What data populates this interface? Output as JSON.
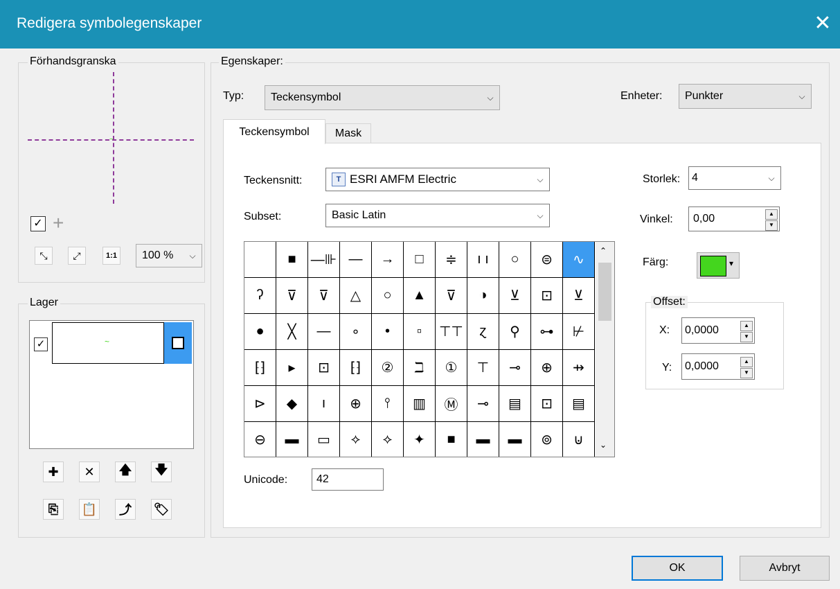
{
  "window": {
    "title": "Redigera symbolegenskaper",
    "close_icon": "close-icon"
  },
  "preview": {
    "label": "Förhandsgranska",
    "checkbox_checked": true,
    "zoom": "100 %",
    "toolbar_icons": [
      "zoom-in-icon",
      "zoom-out-icon",
      "actual-size-icon"
    ],
    "toolbar_glyphs": {
      "fit": "⤡",
      "full": "⤢",
      "actual": "1:1"
    }
  },
  "layers": {
    "label": "Lager",
    "items": [
      {
        "checked": true,
        "preview_glyph": "~",
        "lock_icon": "layer-lock-icon"
      }
    ],
    "buttons_row1": [
      {
        "name": "add-layer-button",
        "glyph": "✚"
      },
      {
        "name": "remove-layer-button",
        "glyph": "✕"
      },
      {
        "name": "move-up-button",
        "glyph": "🡅"
      },
      {
        "name": "move-down-button",
        "glyph": "🡇"
      }
    ],
    "buttons_row2": [
      {
        "name": "copy-button",
        "glyph": "⎘"
      },
      {
        "name": "paste-button",
        "glyph": "📋"
      },
      {
        "name": "reset-button",
        "glyph": "⤴"
      },
      {
        "name": "tag-button",
        "glyph": "🏷"
      }
    ]
  },
  "properties": {
    "label": "Egenskaper:",
    "type_label": "Typ:",
    "type_value": "Teckensymbol",
    "units_label": "Enheter:",
    "units_value": "Punkter",
    "tabs": [
      {
        "label": "Teckensymbol",
        "active": true
      },
      {
        "label": "Mask",
        "active": false
      }
    ],
    "font_label": "Teckensnitt:",
    "font_value": "ESRI AMFM Electric",
    "subset_label": "Subset:",
    "subset_value": "Basic Latin",
    "unicode_label": "Unicode:",
    "unicode_value": "42",
    "size_label": "Storlek:",
    "size_value": "4",
    "angle_label": "Vinkel:",
    "angle_value": "0,00",
    "color_label": "Färg:",
    "color_value": "#44d61e",
    "offset_label": "Offset:",
    "x_label": "X:",
    "x_value": "0,0000",
    "y_label": "Y:",
    "y_value": "0,0000"
  },
  "glyphs": [
    [
      " ",
      "■",
      "—⊪",
      "—",
      "→",
      "□",
      "≑",
      "ı ı",
      "○",
      "⊜",
      "∿"
    ],
    [
      "ʔ",
      "⊽",
      "⊽",
      "△",
      "○",
      "▲",
      "⊽",
      "◑",
      "⊻",
      "⊡",
      "⊻"
    ],
    [
      "●",
      "╳",
      "—",
      "∘",
      "•",
      "▫",
      "⊤⊤",
      "ɀ",
      "⚲",
      "⊶",
      "⊬"
    ],
    [
      "⁅⁆",
      "▸",
      "⊡",
      "⁅⁆",
      "②",
      "ℶ",
      "①",
      "⊤",
      "⊸",
      "⊕",
      "⇸"
    ],
    [
      "⊳",
      "◆",
      "ı",
      "⊕",
      "⫯",
      "▥",
      "Ⓜ",
      "⊸",
      "▤",
      "⊡",
      "▤"
    ],
    [
      "⊖",
      "▬",
      "▭",
      "⟡",
      "⟡",
      "✦",
      "■",
      "▬",
      "▬",
      "⊚",
      "⊍"
    ]
  ],
  "selected_glyph": {
    "row": 0,
    "col": 10
  },
  "dialog_buttons": {
    "ok": "OK",
    "cancel": "Avbryt"
  }
}
